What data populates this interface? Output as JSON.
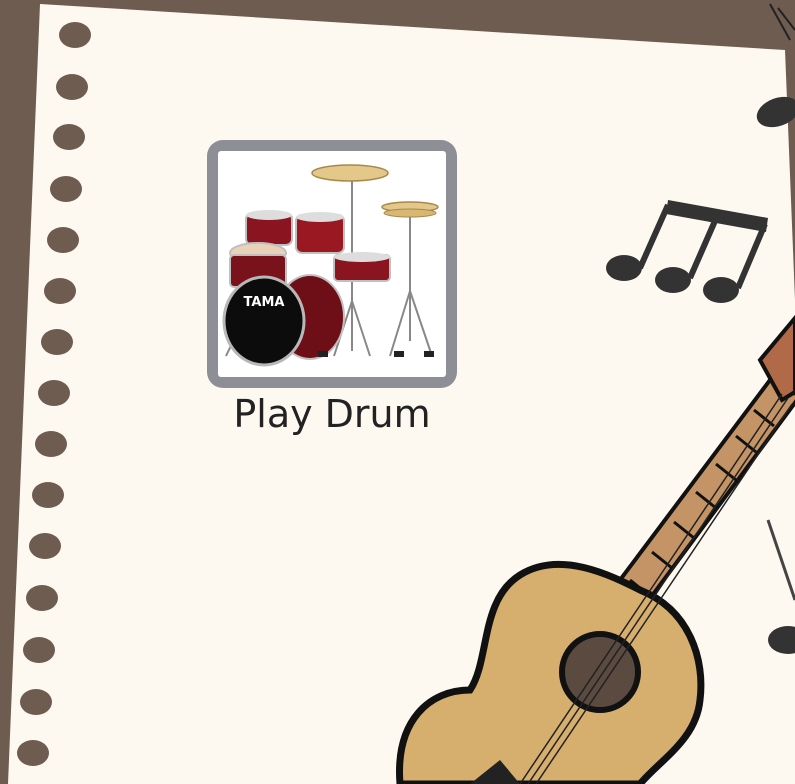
{
  "page": {
    "background_color": "#6e5c50",
    "paper_color": "#fdf9f1"
  },
  "drum_tile": {
    "label": "Play Drum",
    "brand_text": "TAMA",
    "icon": "drum-kit-icon",
    "frame_color": "#8d8e96"
  },
  "decorations": {
    "music_note_icon": "beamed-notes-icon",
    "guitar_icon": "acoustic-guitar-icon"
  }
}
